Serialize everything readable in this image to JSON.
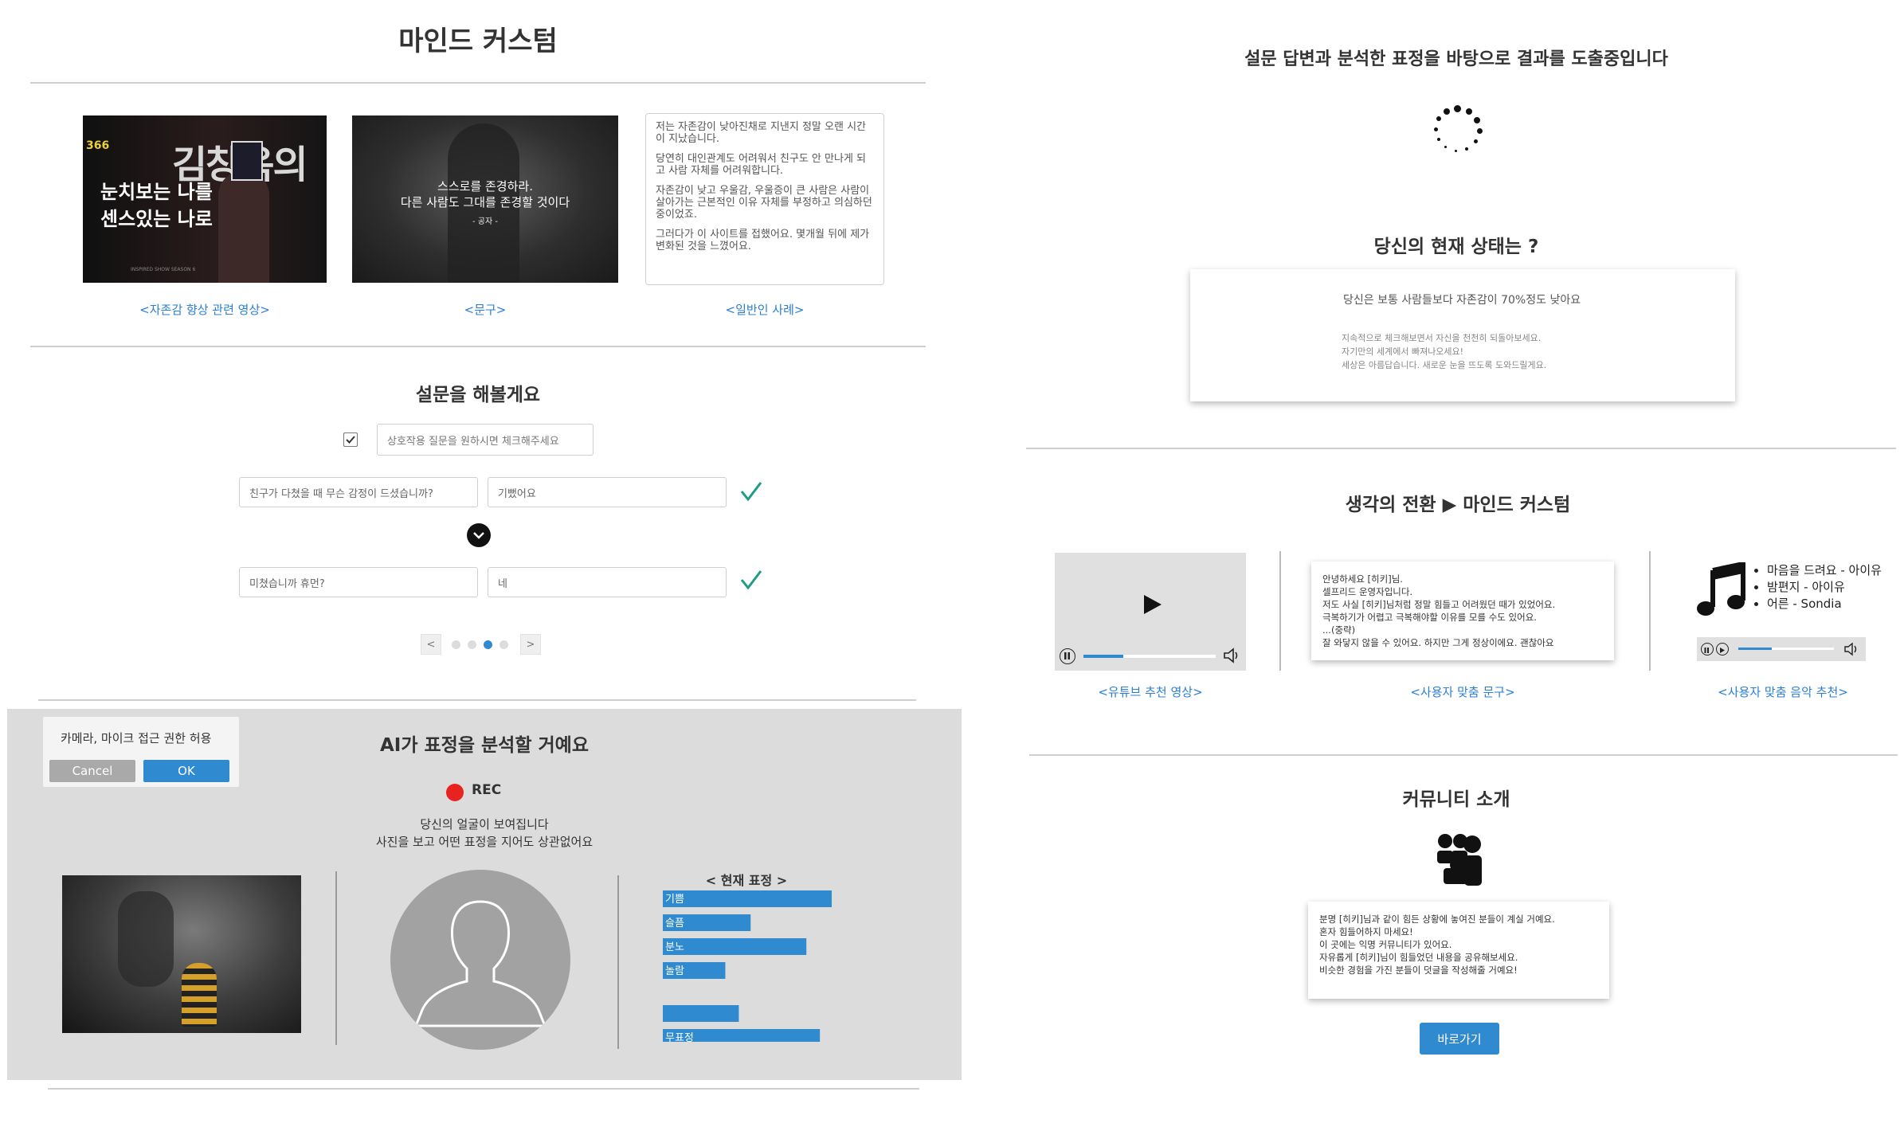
{
  "left": {
    "title": "마인드 커스텀",
    "cards": [
      {
        "thumb_brand": "366",
        "thumb_name": "김창옥의",
        "thumb_line1": "눈치보는 나를",
        "thumb_line2": "센스있는 나로",
        "thumb_footer": "INSPIRED SHOW SEASON 6",
        "link": "<자존감 향상 관련 영상>"
      },
      {
        "quote_line1": "스스로를 존경하라.",
        "quote_line2": "다른 사람도 그대를 존경할 것이다",
        "quote_author": "- 공자 -",
        "link": "<문구>"
      },
      {
        "paragraphs": [
          "저는 자존감이 낮아진채로 지낸지 정말 오랜 시간이 지났습니다.",
          "당연히 대인관계도 어려워서 친구도 안 만나게 되고 사람 자체를 어려워합니다.",
          "자존감이 낮고 우울감, 우울증이 큰 사람은 사람이 살아가는 근본적인 이유 자체를 부정하고 의심하던 중이었죠.",
          "그러다가 이 사이트를 접했어요. 몇개월 뒤에 제가 변화된 것을 느꼈어요."
        ],
        "link": "<일반인 사례>"
      }
    ],
    "survey": {
      "title": "설문을 해볼게요",
      "interaction_placeholder": "상호작용 질문을 원하시면 체크해주세요",
      "q1": "친구가 다쳤을 때 무슨 감정이 드셨습니까?",
      "a1": "기뻤어요",
      "q2": "미쳤습니까 휴먼?",
      "a2": "네",
      "prev": "<",
      "next": ">"
    },
    "ai": {
      "permission_text": "카메라, 마이크 접근 권한 허용",
      "cancel": "Cancel",
      "ok": "OK",
      "title": "AI가 표정을 분석할 거예요",
      "rec": "REC",
      "desc1": "당신의 얼굴이 보여집니다",
      "desc2": "사진을 보고 어떤 표정을 지어도 상관없어요",
      "chart_title": "< 현재 표정 >",
      "accent": "#2f8ad0"
    },
    "chart_data": {
      "type": "bar",
      "title": "< 현재 표정 >",
      "categories": [
        "기쁨",
        "슬픔",
        "분노",
        "놀람",
        "",
        "무표정"
      ],
      "values": [
        100,
        52,
        85,
        37,
        45,
        93
      ]
    }
  },
  "right": {
    "loading_title": "설문 답변과 분석한 표정을 바탕으로 결과를 도출중입니다",
    "status_title": "당신의 현재 상태는 ?",
    "status_main": "당신은 보통 사람들보다 자존감이 70%정도 낮아요",
    "status_lines": [
      "지속적으로 체크해보면서 자신을 천천히 되돌아보세요.",
      "자기만의 세계에서 빠져나오세요!",
      "세상은 아름답습니다. 새로운 눈을 뜨도록 도와드릴게요."
    ],
    "transition_title": "생각의 전환 ▶ 마인드 커스텀",
    "letter_lines": [
      "안녕하세요 [히키]님.",
      "셀프리드 운영자입니다.",
      "저도 사실 [히키]님처럼 정말 힘들고 어려웠던 때가 있었어요.",
      "극복하기가 어렵고 극복해야할 이유를 모를 수도 있어요.",
      "...(중략)",
      "잘 와닿지 않을 수 있어요. 하지만 그게 정상이에요. 괜찮아요"
    ],
    "music_list": [
      "마음을 드려요 - 아이유",
      "밤편지 - 아이유",
      "어른 - Sondia"
    ],
    "links": [
      "<유튜브 추천 영상>",
      "<사용자 맞춤 문구>",
      "<사용자 맞춤 음악 추천>"
    ],
    "community_title": "커뮤니티 소개",
    "community_lines": [
      "분명 [히키]님과 같이 힘든 상황에 놓여진 분들이 계실 거예요.",
      "혼자 힘들어하지 마세요!",
      "이 곳에는 익명 커뮤니티가 있어요.",
      "자유롭게 [히키]님이 힘들었던 내용을 공유해보세요.",
      "비슷한 경험을 가진 분들이 덧글을 작성해줄 거예요!"
    ],
    "go_button": "바로가기",
    "progress": {
      "video": 0.3,
      "music": 0.35
    }
  },
  "icons": [
    "checkbox-icon",
    "check-mark-icon",
    "chevron-down-icon",
    "rec-dot-icon",
    "user-silhouette-icon",
    "spinner-icon",
    "play-icon",
    "pause-icon",
    "volume-icon",
    "music-note-icon",
    "people-group-icon"
  ]
}
